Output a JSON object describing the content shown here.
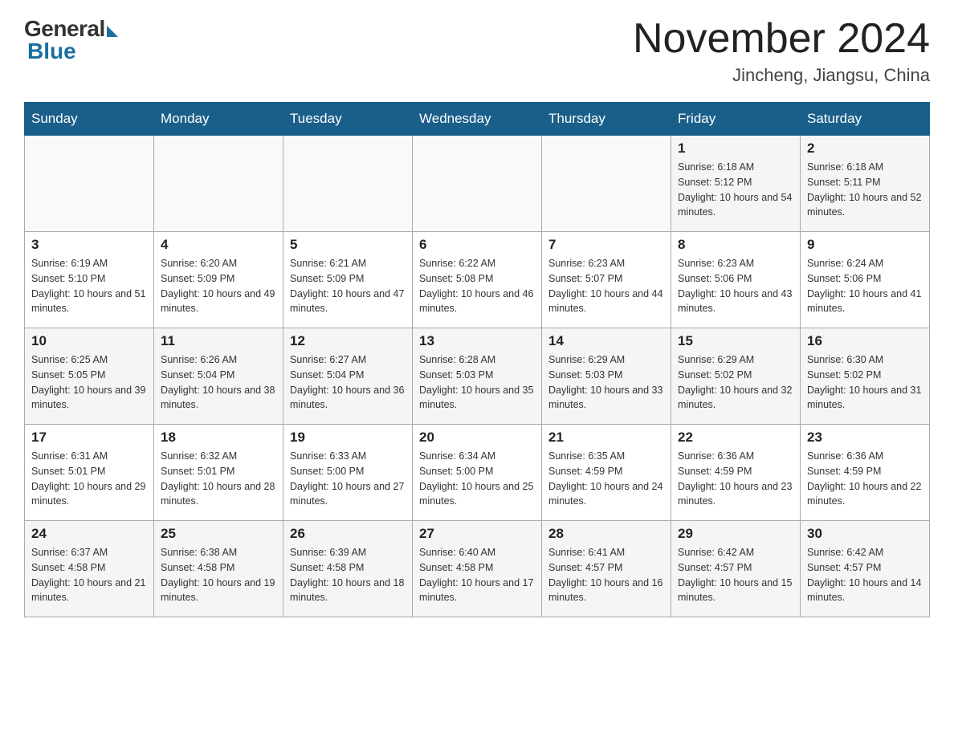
{
  "header": {
    "logo_general": "General",
    "logo_blue": "Blue",
    "month_title": "November 2024",
    "location": "Jincheng, Jiangsu, China"
  },
  "weekdays": [
    "Sunday",
    "Monday",
    "Tuesday",
    "Wednesday",
    "Thursday",
    "Friday",
    "Saturday"
  ],
  "weeks": [
    [
      {
        "day": "",
        "info": ""
      },
      {
        "day": "",
        "info": ""
      },
      {
        "day": "",
        "info": ""
      },
      {
        "day": "",
        "info": ""
      },
      {
        "day": "",
        "info": ""
      },
      {
        "day": "1",
        "info": "Sunrise: 6:18 AM\nSunset: 5:12 PM\nDaylight: 10 hours and 54 minutes."
      },
      {
        "day": "2",
        "info": "Sunrise: 6:18 AM\nSunset: 5:11 PM\nDaylight: 10 hours and 52 minutes."
      }
    ],
    [
      {
        "day": "3",
        "info": "Sunrise: 6:19 AM\nSunset: 5:10 PM\nDaylight: 10 hours and 51 minutes."
      },
      {
        "day": "4",
        "info": "Sunrise: 6:20 AM\nSunset: 5:09 PM\nDaylight: 10 hours and 49 minutes."
      },
      {
        "day": "5",
        "info": "Sunrise: 6:21 AM\nSunset: 5:09 PM\nDaylight: 10 hours and 47 minutes."
      },
      {
        "day": "6",
        "info": "Sunrise: 6:22 AM\nSunset: 5:08 PM\nDaylight: 10 hours and 46 minutes."
      },
      {
        "day": "7",
        "info": "Sunrise: 6:23 AM\nSunset: 5:07 PM\nDaylight: 10 hours and 44 minutes."
      },
      {
        "day": "8",
        "info": "Sunrise: 6:23 AM\nSunset: 5:06 PM\nDaylight: 10 hours and 43 minutes."
      },
      {
        "day": "9",
        "info": "Sunrise: 6:24 AM\nSunset: 5:06 PM\nDaylight: 10 hours and 41 minutes."
      }
    ],
    [
      {
        "day": "10",
        "info": "Sunrise: 6:25 AM\nSunset: 5:05 PM\nDaylight: 10 hours and 39 minutes."
      },
      {
        "day": "11",
        "info": "Sunrise: 6:26 AM\nSunset: 5:04 PM\nDaylight: 10 hours and 38 minutes."
      },
      {
        "day": "12",
        "info": "Sunrise: 6:27 AM\nSunset: 5:04 PM\nDaylight: 10 hours and 36 minutes."
      },
      {
        "day": "13",
        "info": "Sunrise: 6:28 AM\nSunset: 5:03 PM\nDaylight: 10 hours and 35 minutes."
      },
      {
        "day": "14",
        "info": "Sunrise: 6:29 AM\nSunset: 5:03 PM\nDaylight: 10 hours and 33 minutes."
      },
      {
        "day": "15",
        "info": "Sunrise: 6:29 AM\nSunset: 5:02 PM\nDaylight: 10 hours and 32 minutes."
      },
      {
        "day": "16",
        "info": "Sunrise: 6:30 AM\nSunset: 5:02 PM\nDaylight: 10 hours and 31 minutes."
      }
    ],
    [
      {
        "day": "17",
        "info": "Sunrise: 6:31 AM\nSunset: 5:01 PM\nDaylight: 10 hours and 29 minutes."
      },
      {
        "day": "18",
        "info": "Sunrise: 6:32 AM\nSunset: 5:01 PM\nDaylight: 10 hours and 28 minutes."
      },
      {
        "day": "19",
        "info": "Sunrise: 6:33 AM\nSunset: 5:00 PM\nDaylight: 10 hours and 27 minutes."
      },
      {
        "day": "20",
        "info": "Sunrise: 6:34 AM\nSunset: 5:00 PM\nDaylight: 10 hours and 25 minutes."
      },
      {
        "day": "21",
        "info": "Sunrise: 6:35 AM\nSunset: 4:59 PM\nDaylight: 10 hours and 24 minutes."
      },
      {
        "day": "22",
        "info": "Sunrise: 6:36 AM\nSunset: 4:59 PM\nDaylight: 10 hours and 23 minutes."
      },
      {
        "day": "23",
        "info": "Sunrise: 6:36 AM\nSunset: 4:59 PM\nDaylight: 10 hours and 22 minutes."
      }
    ],
    [
      {
        "day": "24",
        "info": "Sunrise: 6:37 AM\nSunset: 4:58 PM\nDaylight: 10 hours and 21 minutes."
      },
      {
        "day": "25",
        "info": "Sunrise: 6:38 AM\nSunset: 4:58 PM\nDaylight: 10 hours and 19 minutes."
      },
      {
        "day": "26",
        "info": "Sunrise: 6:39 AM\nSunset: 4:58 PM\nDaylight: 10 hours and 18 minutes."
      },
      {
        "day": "27",
        "info": "Sunrise: 6:40 AM\nSunset: 4:58 PM\nDaylight: 10 hours and 17 minutes."
      },
      {
        "day": "28",
        "info": "Sunrise: 6:41 AM\nSunset: 4:57 PM\nDaylight: 10 hours and 16 minutes."
      },
      {
        "day": "29",
        "info": "Sunrise: 6:42 AM\nSunset: 4:57 PM\nDaylight: 10 hours and 15 minutes."
      },
      {
        "day": "30",
        "info": "Sunrise: 6:42 AM\nSunset: 4:57 PM\nDaylight: 10 hours and 14 minutes."
      }
    ]
  ]
}
